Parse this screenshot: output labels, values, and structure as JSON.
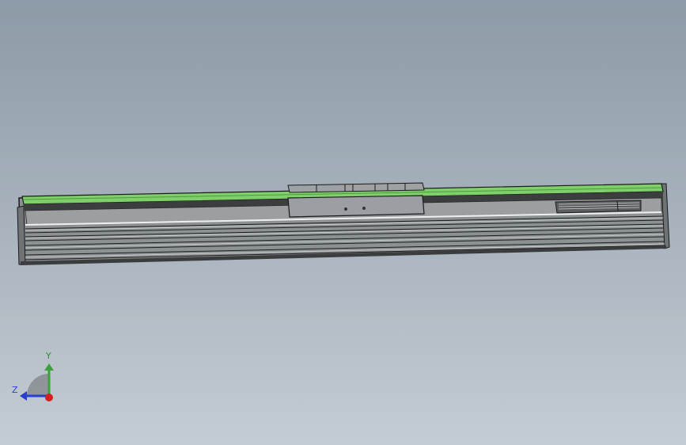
{
  "viewport": {
    "background_top": "#8d9aa7",
    "background_bottom": "#c4ccd3"
  },
  "model": {
    "body_color": "#8a8f93",
    "top_rail_color": "#7fd06b",
    "edge_color": "#1c1c1c",
    "highlight_color": "#e6e6e6"
  },
  "triad": {
    "y_label": "Y",
    "z_label": "Z",
    "y_color": "#3aa23a",
    "z_color": "#2a3fd0",
    "x_color": "#d02020",
    "icons": [
      "triad-y-arrow-icon",
      "triad-z-arrow-icon",
      "triad-x-origin-icon"
    ]
  }
}
